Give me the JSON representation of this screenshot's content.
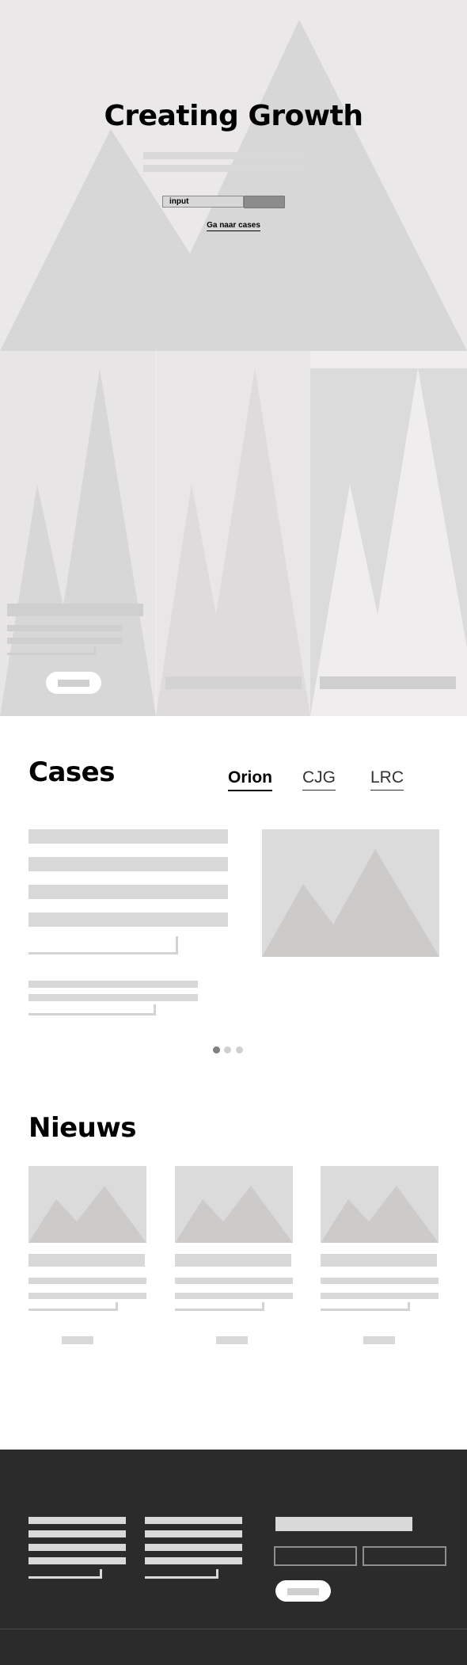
{
  "hero": {
    "title": "Creating Growth",
    "input_placeholder": "input",
    "link_label": "Ga naar cases"
  },
  "cases": {
    "title": "Cases",
    "tabs": [
      {
        "label": "Orion",
        "active": true
      },
      {
        "label": "CJG",
        "active": false
      },
      {
        "label": "LRC",
        "active": false
      }
    ],
    "carousel_pages": 3,
    "carousel_active": 1
  },
  "news": {
    "title": "Nieuws",
    "card_count": 3
  },
  "colors": {
    "footer_bg": "#2b2b2b",
    "placeholder": "#d9d8d8",
    "hero_bg": "#eae8e8"
  }
}
